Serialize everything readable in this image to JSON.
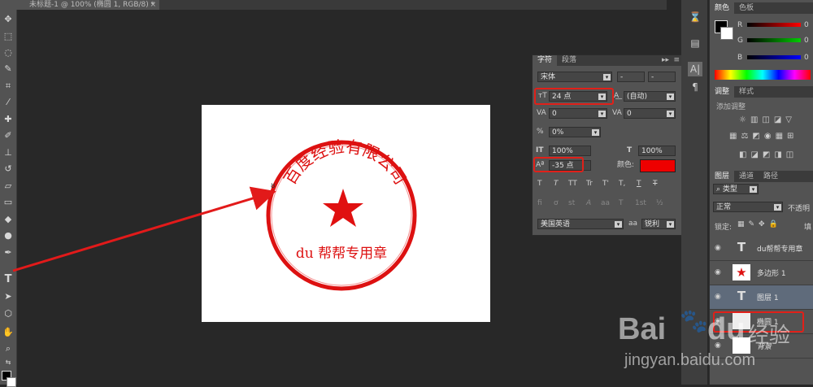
{
  "document": {
    "tab_title": "未标题-1 @ 100% (椭圆 1, RGB/8) *",
    "close": "×"
  },
  "character_panel": {
    "tabs": [
      "字符",
      "段落"
    ],
    "menu_glyph": "▸▸",
    "font_family": "宋体",
    "font_style": "-",
    "font_style_2": "-",
    "font_size": "24 点",
    "leading": "(自动)",
    "kerning": "0",
    "tracking": "0",
    "scale_percent": "0%",
    "vertical_scale": "100%",
    "horizontal_scale": "100%",
    "baseline_shift": "-35 点",
    "color_label": "颜色:",
    "color_value": "#ee0000",
    "style_buttons": [
      "T",
      "T",
      "TT",
      "Tr",
      "T'",
      "T,",
      "T",
      "T"
    ],
    "opentype_buttons": [
      "fi",
      "ơ",
      "st",
      "A",
      "aa",
      "T",
      "1st",
      "½"
    ],
    "language": "美国英语",
    "aa_glyph": "aa",
    "antialias": "锐利"
  },
  "color_panel": {
    "tabs": [
      "颜色",
      "色板"
    ],
    "r_label": "R",
    "g_label": "G",
    "b_label": "B",
    "r": "0",
    "g": "0",
    "b": "0"
  },
  "adjust_panel": {
    "tabs": [
      "调整",
      "样式"
    ],
    "add_label": "添加调整"
  },
  "layers_panel": {
    "tabs": [
      "图层",
      "通道",
      "路径"
    ],
    "filter_label": "类型",
    "blend_mode": "正常",
    "opacity_label": "不透明",
    "lock_label": "锁定:",
    "fill_label": "填",
    "layers": [
      {
        "name": "du帮帮专用章",
        "kind": "text"
      },
      {
        "name": "多边形 1",
        "kind": "shape"
      },
      {
        "name": "图层 1",
        "kind": "text"
      },
      {
        "name": "椭圆 1",
        "kind": "ellipse"
      },
      {
        "name": "背景",
        "kind": "bg"
      }
    ]
  },
  "stamp": {
    "arc_text": "百度经验有限公司",
    "bottom_text": "du 帮帮专用章",
    "color": "#dd1111"
  },
  "watermark": {
    "brand_text": "Bai",
    "du_text": "du",
    "suffix": "经验",
    "url": "jingyan.baidu.com"
  }
}
